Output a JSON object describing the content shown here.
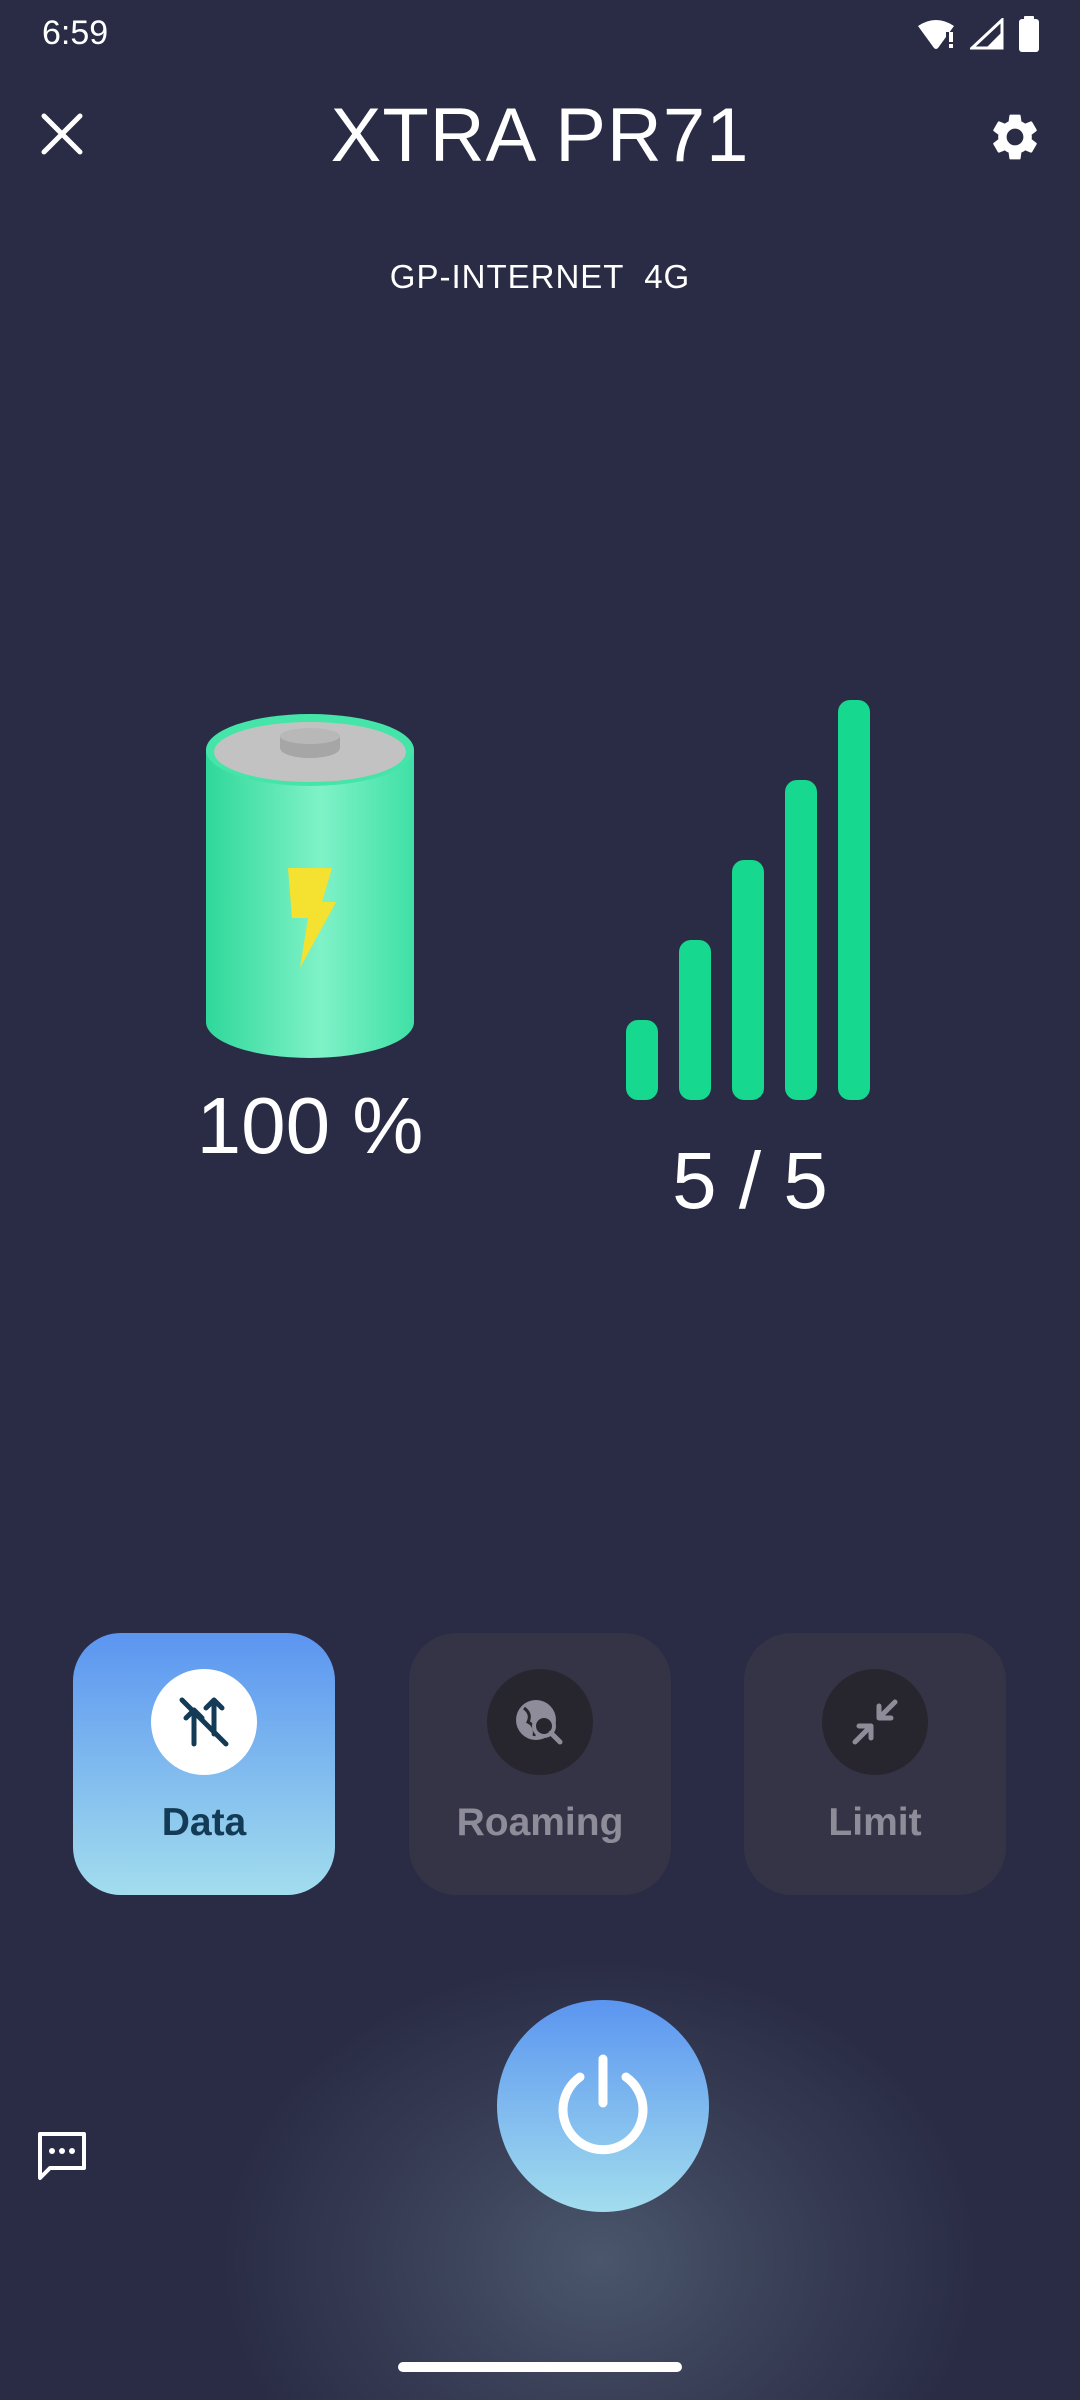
{
  "status_bar": {
    "time": "6:59",
    "icons": [
      "wifi-alert-icon",
      "cell-signal-icon",
      "battery-full-icon"
    ]
  },
  "header": {
    "title": "XTRA PR71",
    "close_icon": "close-icon",
    "settings_icon": "gear-icon"
  },
  "network": {
    "label": "GP-INTERNET  4G"
  },
  "battery": {
    "level_percent": 100,
    "label": "100 %",
    "charging": true
  },
  "signal": {
    "bars": 5,
    "max_bars": 5,
    "label": "5 / 5"
  },
  "tiles": [
    {
      "label": "Data",
      "icon": "mobile-data-off-icon",
      "active": true
    },
    {
      "label": "Roaming",
      "icon": "roaming-globe-search-icon",
      "active": false
    },
    {
      "label": "Limit",
      "icon": "collapse-arrows-icon",
      "active": false
    }
  ],
  "power": {
    "icon": "power-icon"
  },
  "footer": {
    "message_icon": "message-icon"
  },
  "colors": {
    "background": "#2a2c45",
    "accent_gradient_top": "#5b95f0",
    "accent_gradient_bottom": "#a2ddee",
    "battery_green": "#3ee6a0",
    "signal_green": "#17d88f",
    "bolt_yellow": "#f5e12f",
    "tile_inactive": "#353447"
  }
}
